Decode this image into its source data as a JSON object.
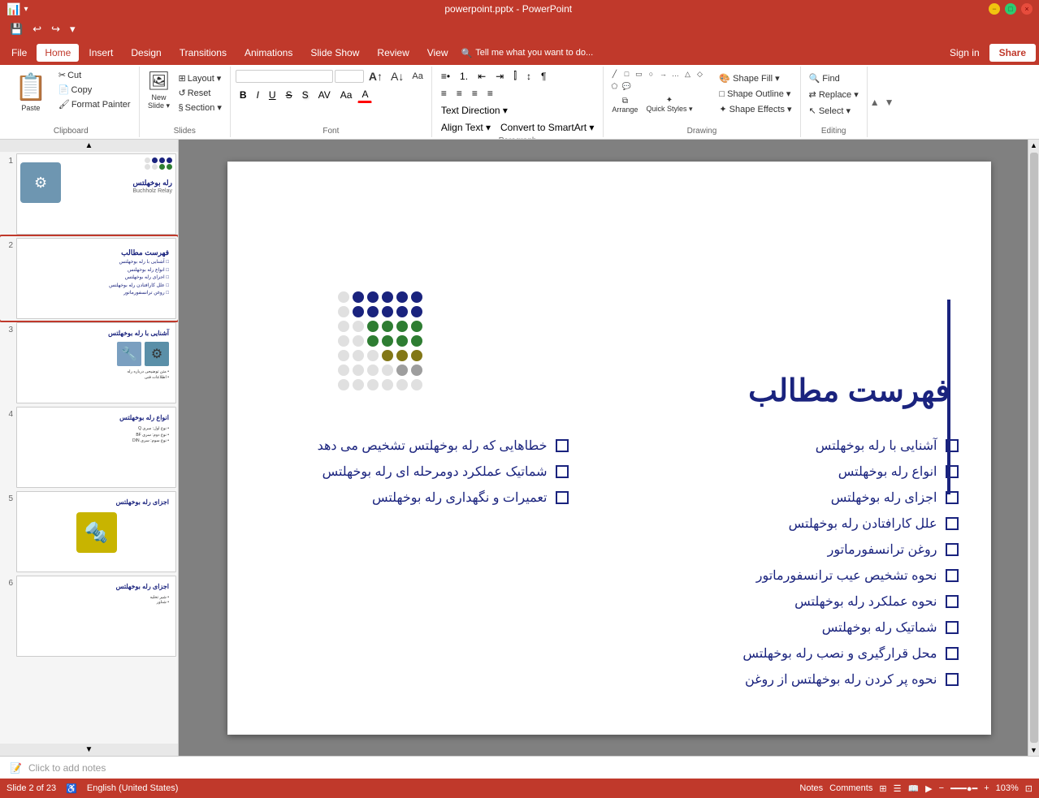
{
  "window": {
    "title": "powerpoint.pptx - PowerPoint",
    "controls": [
      "minimize",
      "maximize",
      "close"
    ]
  },
  "quick_access": {
    "buttons": [
      "save",
      "undo",
      "redo",
      "customize"
    ]
  },
  "menu_bar": {
    "items": [
      "File",
      "Home",
      "Insert",
      "Design",
      "Transitions",
      "Animations",
      "Slide Show",
      "Review",
      "View"
    ],
    "active": "Home",
    "search_placeholder": "Tell me what you want to do...",
    "sign_in": "Sign in",
    "share": "Share"
  },
  "ribbon": {
    "groups": [
      {
        "name": "Clipboard",
        "label": "Clipboard",
        "buttons": [
          "Paste",
          "Cut",
          "Copy",
          "Format Painter"
        ]
      },
      {
        "name": "Slides",
        "label": "Slides",
        "buttons": [
          "New Slide",
          "Layout",
          "Reset",
          "Section"
        ]
      },
      {
        "name": "Font",
        "label": "Font",
        "font_name": "",
        "font_size": "",
        "buttons": [
          "Bold",
          "Italic",
          "Underline",
          "Strikethrough",
          "Shadow",
          "Char Spacing",
          "Change Case",
          "Font Color",
          "Increase Font",
          "Decrease Font",
          "Clear Formatting"
        ]
      },
      {
        "name": "Paragraph",
        "label": "Paragraph",
        "buttons": [
          "Bullets",
          "Numbering",
          "Decrease Indent",
          "Increase Indent",
          "Columns",
          "Align Left",
          "Center",
          "Align Right",
          "Justify",
          "Text Direction",
          "Align Text",
          "Convert to SmartArt",
          "Line Spacing"
        ]
      },
      {
        "name": "Drawing",
        "label": "Drawing",
        "buttons": [
          "Arrange",
          "Quick Styles",
          "Shape Fill",
          "Shape Outline",
          "Shape Effects"
        ]
      },
      {
        "name": "Editing",
        "label": "Editing",
        "buttons": [
          "Find",
          "Replace",
          "Select"
        ]
      }
    ],
    "text_direction_label": "Text Direction",
    "quick_styles_label": "Quick Styles",
    "shape_effects_label": "Shape Effects",
    "section_label": "Section",
    "select_label": "Select"
  },
  "slides": [
    {
      "num": 1,
      "title": "رله بوخهلتس",
      "subtitle": "Buchholz Relay",
      "thumb_desc": "Title slide with blue relay image"
    },
    {
      "num": 2,
      "title": "فهرست مطالب",
      "thumb_desc": "Table of contents slide - active",
      "active": true
    },
    {
      "num": 3,
      "title": "آشنایی با رله بوخهلتس",
      "thumb_desc": "Slide about Buchholz relay introduction"
    },
    {
      "num": 4,
      "title": "انواع رله بوخهلتس",
      "thumb_desc": "Types of Buchholz relay"
    },
    {
      "num": 5,
      "title": "اجزای رله بوخهلتس",
      "thumb_desc": "Parts of Buchholz relay with yellow device image"
    },
    {
      "num": 6,
      "title": "اجزای رله بوخهلتس",
      "thumb_desc": "More parts slide"
    }
  ],
  "slide": {
    "title": "فهرست مطالب",
    "items_right": [
      "آشنایی با رله بوخهلتس",
      "انواع رله بوخهلتس",
      "اجزای رله بوخهلتس",
      "علل کارافتادن رله بوخهلتس",
      "روغن ترانسفورماتور",
      "نحوه تشخیص عیب ترانسفورماتور",
      "نحوه عملکرد رله بوخهلتس",
      "شماتیک رله بوخهلتس",
      "محل قرارگیری و نصب رله بوخهلتس",
      "نحوه پر کردن رله بوخهلتس از روغن"
    ],
    "items_left": [
      "خطاهایی که رله بوخهلتس تشخیص می دهد",
      "شماتیک عملکرد دومرحله ای رله بوخهلتس",
      "تعمیرات و نگهداری رله بوخهلتس"
    ],
    "notes_placeholder": "Click to add notes"
  },
  "status_bar": {
    "slide_info": "Slide 2 of 23",
    "language": "English (United States)",
    "notes_label": "Notes",
    "comments_label": "Comments",
    "zoom": "103%"
  },
  "dots_colors": [
    "#1a237e",
    "#1a237e",
    "#1a237e",
    "#1a237e",
    "#1a237e",
    "#e0e0e0",
    "#1a237e",
    "#1a237e",
    "#1a237e",
    "#1a237e",
    "#1a237e",
    "#e0e0e0",
    "#2e7d32",
    "#2e7d32",
    "#2e7d32",
    "#2e7d32",
    "#e0e0e0",
    "#e0e0e0",
    "#2e7d32",
    "#2e7d32",
    "#2e7d32",
    "#2e7d32",
    "#e0e0e0",
    "#e0e0e0",
    "#827717",
    "#827717",
    "#827717",
    "#e0e0e0",
    "#e0e0e0",
    "#e0e0e0",
    "#9e9e9e",
    "#9e9e9e",
    "#e0e0e0",
    "#e0e0e0",
    "#e0e0e0",
    "#e0e0e0",
    "#e0e0e0",
    "#e0e0e0",
    "#e0e0e0",
    "#e0e0e0",
    "#e0e0e0",
    "#e0e0e0"
  ]
}
